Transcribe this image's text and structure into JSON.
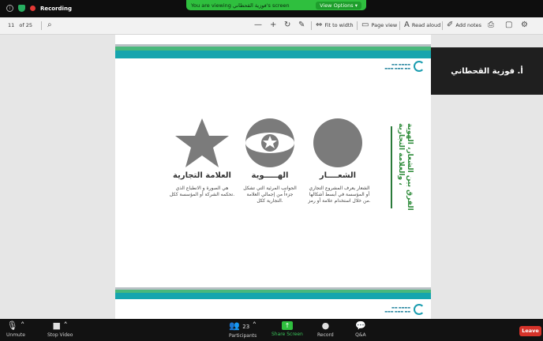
{
  "zoom": {
    "recording_label": "Recording",
    "viewing_banner": "You are viewing فوزية القحطاني's screen",
    "view_options": "View Options",
    "participant_name": "أ. فوزية القحطاني",
    "controls": {
      "unmute": "Unmute",
      "stop_video": "Stop Video",
      "participants": "Participants",
      "participants_count": "23",
      "share_screen": "Share Screen",
      "record": "Record",
      "qa": "Q&A",
      "leave": "Leave"
    }
  },
  "pdf_toolbar": {
    "page_current": "11",
    "page_total": "of 25",
    "fit_to_width": "Fit to width",
    "page_view": "Page view",
    "read_aloud": "Read aloud",
    "add_notes": "Add notes"
  },
  "slide": {
    "vertical_title": "الفرق بين الشعار، الهوية ، والعلامة التجارية",
    "items": [
      {
        "title": "الشعــــار",
        "desc": "الشعار يعرف المشروع التجاري أو المؤسسة في أبسط أشكالها من خلال استخدام علامة أو رمز."
      },
      {
        "title": "الهـــــوية",
        "desc": "الجوانب المرئية التي تشكل جزءاً من إجمالي العلامة التجارية ككل."
      },
      {
        "title": "العلامة التجارية",
        "desc": "هي الصورة و الانطباع الذي تحكمه الشركة أو المؤسسة ككل."
      }
    ]
  },
  "colors": {
    "banner_green": "#2fbf3e",
    "accent_teal": "#16a5ae",
    "accent_green": "#49b87c",
    "leave_red": "#d6332a",
    "shape_gray": "#7b7b7b"
  }
}
